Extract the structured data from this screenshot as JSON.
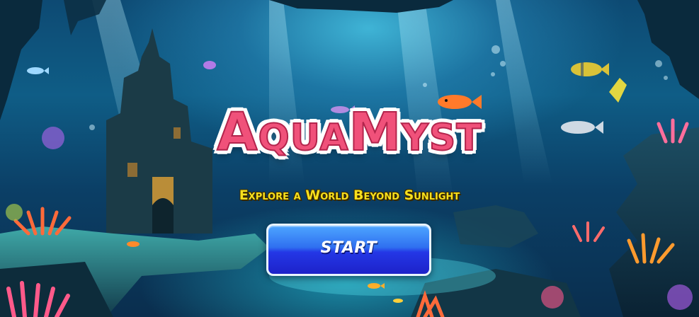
{
  "game": {
    "title": "AquaMyst",
    "subtitle": "Explore a World Beyond Sunlight",
    "start_label": "START"
  },
  "colors": {
    "title_fill": "#f0517a",
    "title_outline": "#ffffff",
    "subtitle": "#f7e01d",
    "button_top": "#4da6ff",
    "button_bottom": "#1d22c9",
    "water_deep": "#0a2e4e",
    "water_light": "#3fb4d6"
  },
  "scene": {
    "icons": [
      "castle-icon",
      "coral-icon",
      "fish-icon",
      "rock-icon",
      "light-ray-icon"
    ]
  }
}
